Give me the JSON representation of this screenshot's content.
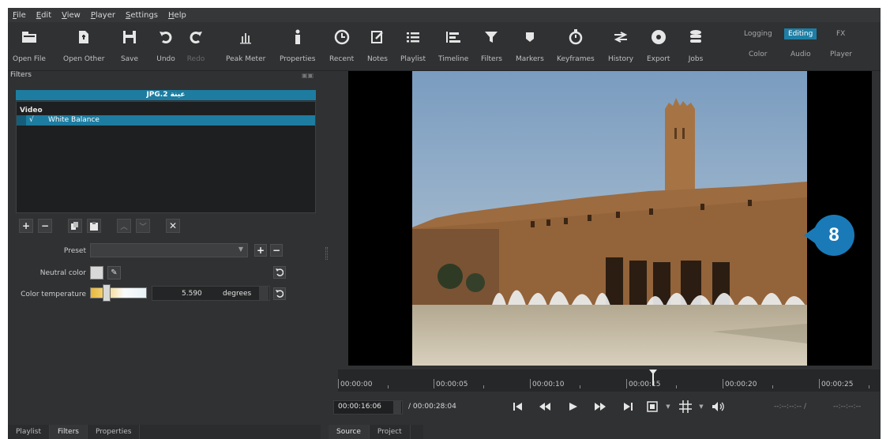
{
  "menu": [
    "File",
    "Edit",
    "View",
    "Player",
    "Settings",
    "Help"
  ],
  "toolbar": [
    {
      "label": "Open File",
      "icon": "folder-open-icon"
    },
    {
      "label": "Open Other",
      "icon": "open-other-icon"
    },
    {
      "label": "Save",
      "icon": "save-icon"
    },
    {
      "label": "Undo",
      "icon": "undo-icon"
    },
    {
      "label": "Redo",
      "icon": "redo-icon"
    },
    {
      "label": "Peak Meter",
      "icon": "peak-meter-icon"
    },
    {
      "label": "Properties",
      "icon": "info-icon"
    },
    {
      "label": "Recent",
      "icon": "clock-icon"
    },
    {
      "label": "Notes",
      "icon": "notes-icon"
    },
    {
      "label": "Playlist",
      "icon": "list-icon"
    },
    {
      "label": "Timeline",
      "icon": "timeline-icon"
    },
    {
      "label": "Filters",
      "icon": "funnel-icon"
    },
    {
      "label": "Markers",
      "icon": "marker-icon"
    },
    {
      "label": "Keyframes",
      "icon": "stopwatch-icon"
    },
    {
      "label": "History",
      "icon": "history-icon"
    },
    {
      "label": "Export",
      "icon": "export-icon"
    },
    {
      "label": "Jobs",
      "icon": "jobs-icon"
    }
  ],
  "layouts": {
    "logging": "Logging",
    "editing": "Editing",
    "fx": "FX",
    "color": "Color",
    "audio": "Audio",
    "player": "Player"
  },
  "filters_panel": {
    "title": "Filters",
    "clip_name": "JPG.2 عينة",
    "category": "Video",
    "filter_check": "√",
    "filter_name": "White Balance",
    "preset_label": "Preset",
    "neutral_label": "Neutral color",
    "temp_label": "Color temperature",
    "temp_value": "5.590",
    "temp_unit": "degrees",
    "temp_slider_level": 0.2,
    "buttons": [
      "add",
      "remove",
      "copy",
      "paste",
      "move-up",
      "move-down",
      "deselect"
    ]
  },
  "bottom_tabs_left": [
    "Playlist",
    "Filters",
    "Properties"
  ],
  "bottom_tabs_right": [
    "Source",
    "Project"
  ],
  "timeline": {
    "ticks": [
      "00:00:00",
      "00:00:05",
      "00:00:10",
      "00:00:15",
      "00:00:20",
      "00:00:25"
    ],
    "current": "00:00:16:06",
    "duration": "/ 00:00:28:04",
    "in_point": "--:--:--:-- /",
    "out_point": "--:--:--:--"
  },
  "callout": {
    "number": "8",
    "color": "#1a7ab8"
  },
  "colors": {
    "accent": "#1d7ca0",
    "bg": "#2f3133"
  }
}
